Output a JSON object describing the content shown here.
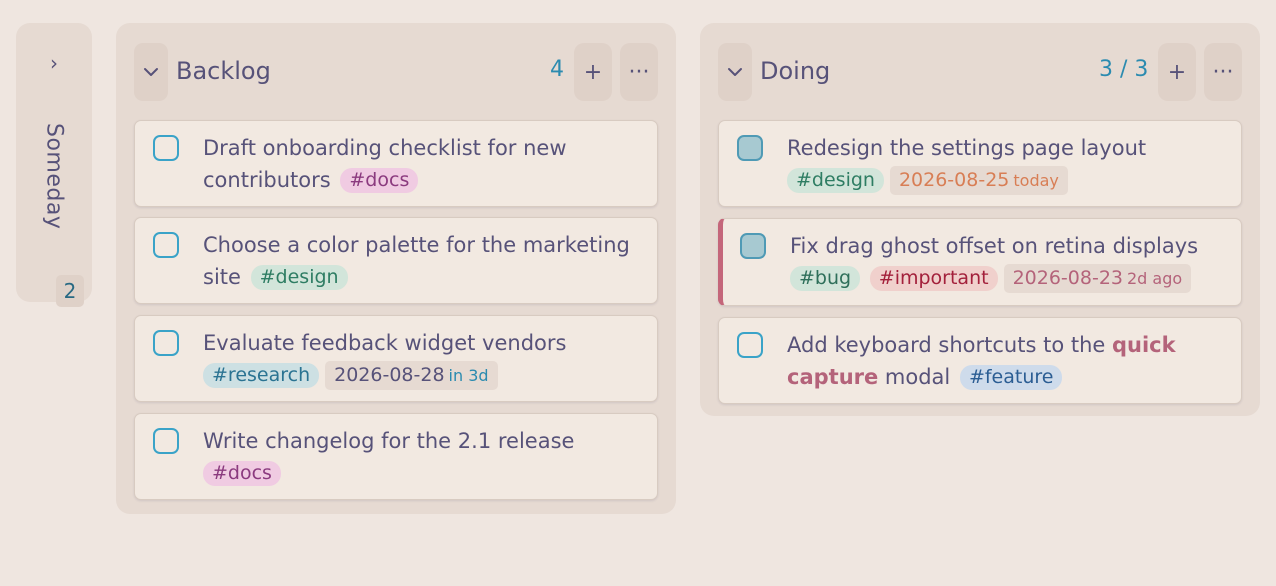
{
  "collapsed_lane": {
    "title": "Someday",
    "count": "2",
    "expand_icon": "chevron-right-icon"
  },
  "lanes": [
    {
      "title": "Backlog",
      "count": "4",
      "add_label": "+",
      "more_label": "···",
      "cards": [
        {
          "text": "Draft onboarding checklist for new contributors",
          "tags": [
            "#docs"
          ]
        },
        {
          "text": "Choose a color palette for the marketing site",
          "tags": [
            "#design"
          ]
        },
        {
          "text": "Evaluate feedback widget vendors",
          "tags": [
            "#research"
          ],
          "date": "2026-08-28",
          "relative": "in 3d"
        },
        {
          "text": "Write changelog for the 2.1 release",
          "tags": [
            "#docs"
          ]
        }
      ]
    },
    {
      "title": "Doing",
      "count": "3 / 3",
      "add_label": "+",
      "more_label": "···",
      "cards": [
        {
          "text": "Redesign the settings page layout",
          "tags": [
            "#design"
          ],
          "date": "2026-08-25",
          "relative": "today"
        },
        {
          "text": "Fix drag ghost offset on retina displays",
          "tags": [
            "#bug",
            "#important"
          ],
          "date": "2026-08-23",
          "relative": "2d ago"
        },
        {
          "text_before": "Add keyboard shortcuts to the ",
          "highlight": "quick capture",
          "text_after": " modal",
          "tags": [
            "#feature"
          ]
        }
      ]
    }
  ],
  "colors": {
    "background": "#efe6e0",
    "lane": "#e6dad2",
    "card": "#f2e9e1",
    "accent": "#2b8bb0",
    "important": "#c4667a"
  }
}
